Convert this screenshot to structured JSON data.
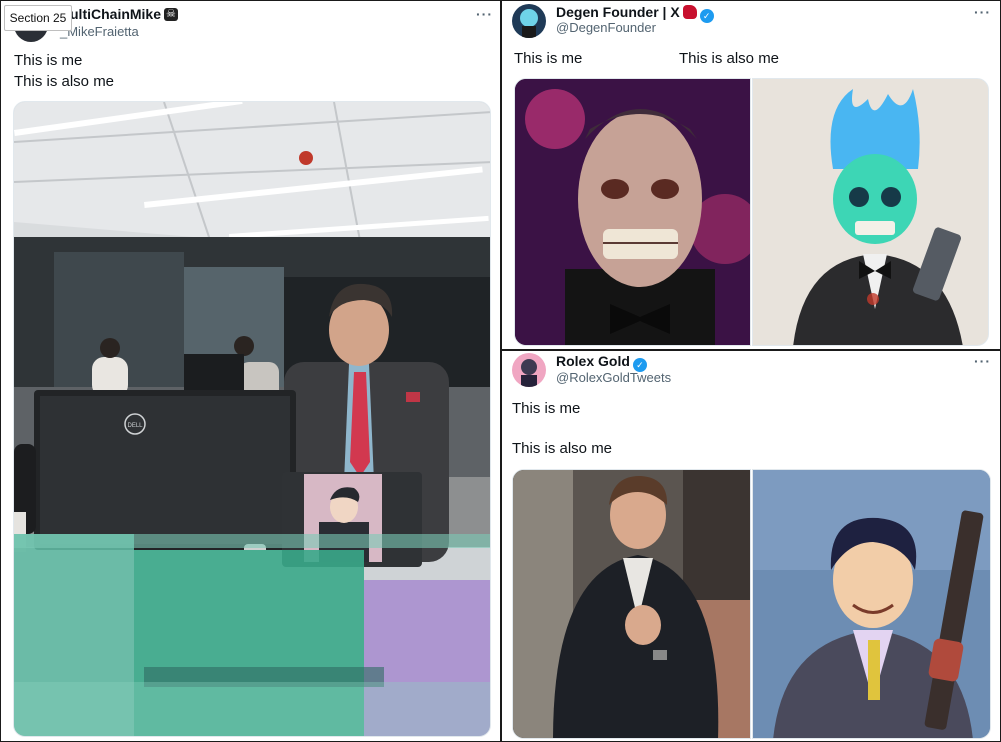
{
  "section_tag": "Section 25",
  "more_label": "···",
  "tweets": [
    {
      "name": "ultiChainMike",
      "handle": "_MikeFraietta",
      "lines": [
        "This is me",
        "This is also me"
      ],
      "media_icon": "office-photo-with-laptop"
    },
    {
      "name": "Degen Founder | X",
      "handle": "@DegenFounder",
      "lines": [
        "This is me",
        "This is also me"
      ],
      "media_icon": "skull-portraits"
    },
    {
      "name": "Rolex Gold",
      "handle": "@RolexGoldTweets",
      "lines": [
        "This is me",
        "This is also me"
      ],
      "media_icon": "suit-portraits"
    }
  ],
  "verified_symbol": "✓",
  "dell_logo": "DELL"
}
